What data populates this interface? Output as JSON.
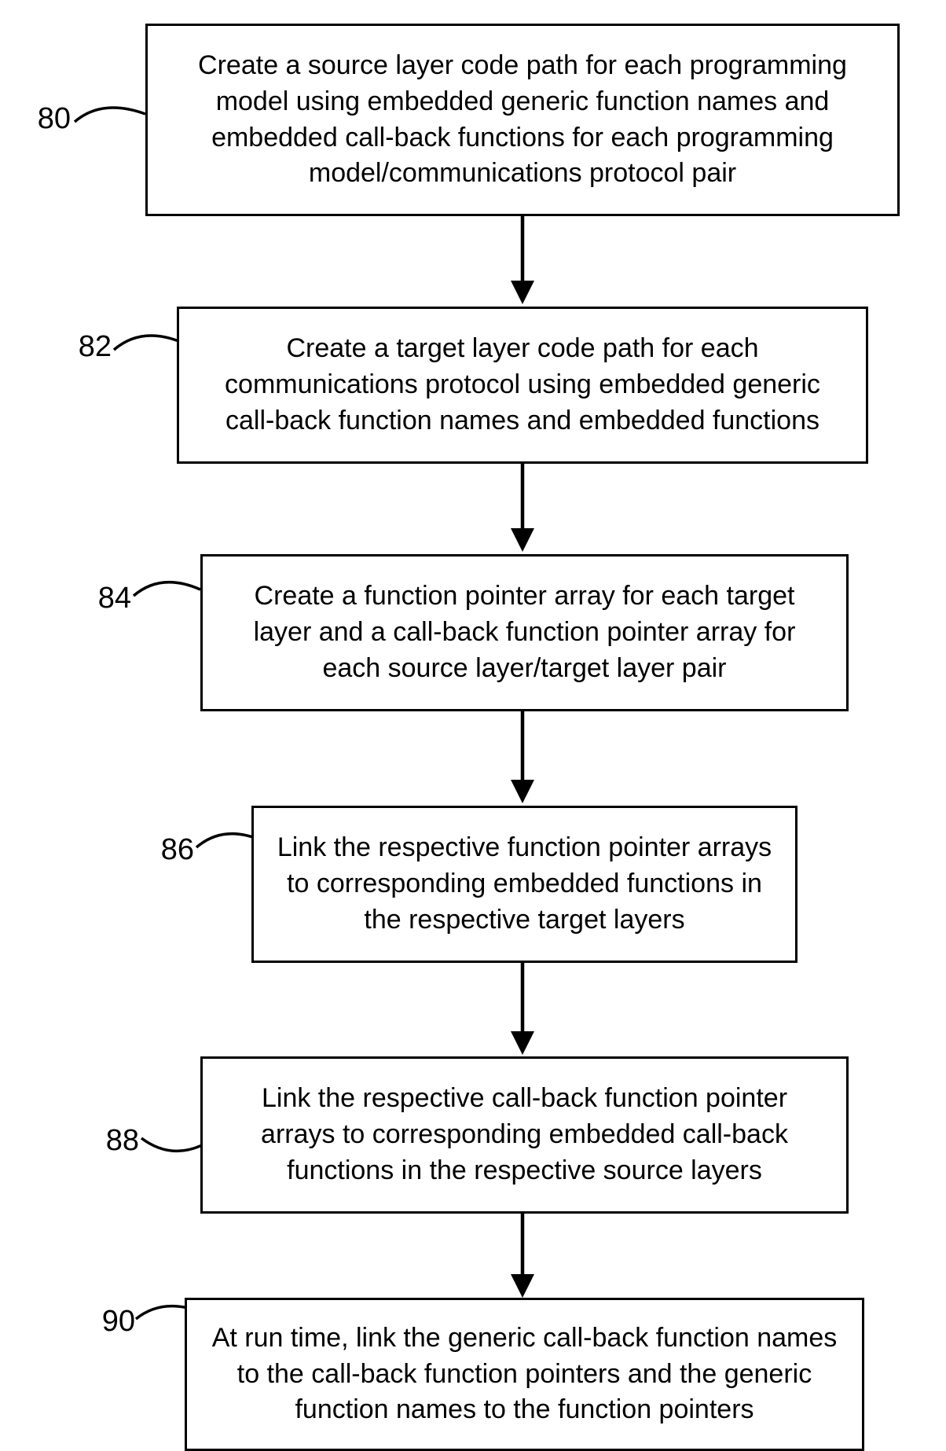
{
  "steps": [
    {
      "num": "80",
      "text": "Create a source layer code path for each programming model using embedded generic function names and embedded call-back functions for each programming model/communications protocol pair"
    },
    {
      "num": "82",
      "text": "Create a target layer code path for each communications protocol using embedded generic call-back function names and embedded functions"
    },
    {
      "num": "84",
      "text": "Create a function pointer array for each target layer and a call-back function pointer array for each source layer/target layer pair"
    },
    {
      "num": "86",
      "text": "Link the respective function pointer arrays to corresponding embedded functions in the respective target layers"
    },
    {
      "num": "88",
      "text": "Link the respective call-back function pointer arrays to corresponding embedded call-back functions in the respective source layers"
    },
    {
      "num": "90",
      "text": "At run time, link the generic call-back function names to the call-back function pointers and the generic function names to the function pointers"
    }
  ]
}
